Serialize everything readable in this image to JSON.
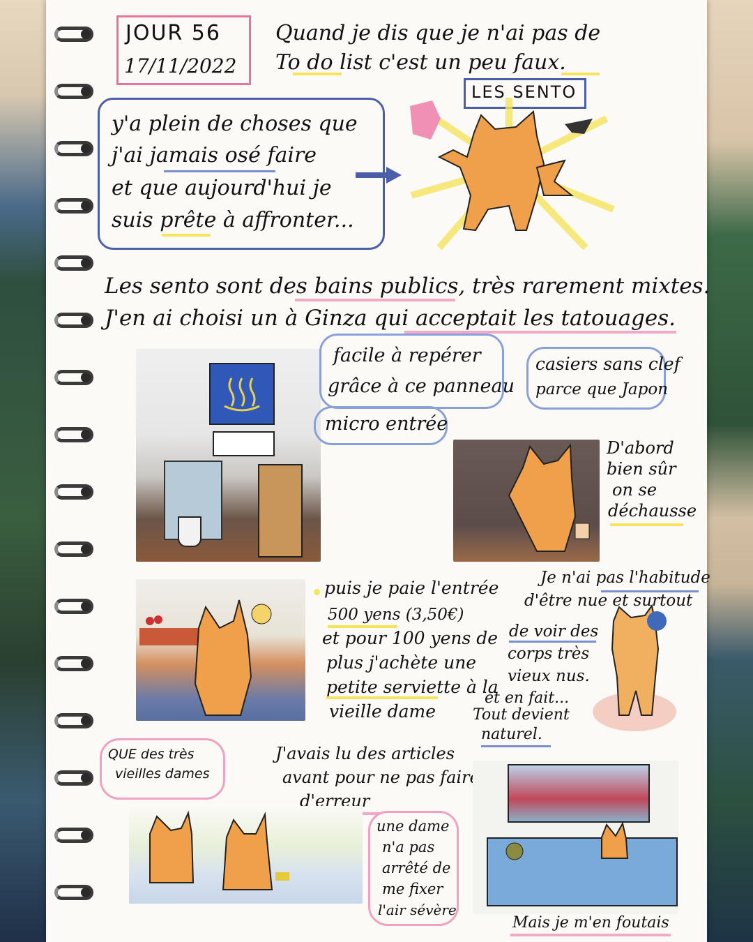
{
  "header": {
    "day_label": "JOUR 56",
    "date": "17/11/2022",
    "intro_line1": "Quand je dis que je n'ai pas de",
    "intro_line2": "To do list c'est un peu faux."
  },
  "bubble_top": {
    "line1": "y'a plein de choses que",
    "line2": "j'ai jamais osé faire",
    "line3": "et que aujourd'hui je",
    "line4": "suis prête à affronter..."
  },
  "sento_label": "LES SENTO",
  "paragraph": {
    "line1": "Les sento sont des bains publics, très rarement mixtes.",
    "line2": "J'en ai choisi un à Ginza qui acceptait les tatouages."
  },
  "notes": {
    "panel_sign_line1": "facile à repérer",
    "panel_sign_line2": "grâce à ce panneau",
    "micro_entree": "micro entrée",
    "casiers_line1": "casiers sans clef",
    "casiers_line2": "parce que Japon",
    "dabord_line1": "D'abord",
    "dabord_line2": "bien sûr",
    "dabord_line3": "on se",
    "dabord_line4": "déchausse",
    "paie_line1": "puis je paie l'entrée",
    "paie_line2": "500 yens (3,50€)",
    "paie_line3": "et pour 100 yens de",
    "paie_line4": "plus j'achète une",
    "paie_line5": "petite serviette à la",
    "paie_line6": "vieille dame",
    "habitude_line1": "Je n'ai pas l'habitude",
    "habitude_line2": "d'être nue et surtout",
    "habitude_line3": "de voir des",
    "habitude_line4": "corps très",
    "habitude_line5": "vieux nus.",
    "habitude_line6": "et en fait...",
    "habitude_line7": "Tout devient",
    "habitude_line8": "naturel.",
    "vieilles_line1": "QUE des très",
    "vieilles_line2": "vieilles dames",
    "articles_line1": "J'avais lu des articles",
    "articles_line2": "avant pour ne pas faire",
    "articles_line3": "d'erreur",
    "dame_line1": "une dame",
    "dame_line2": "n'a pas",
    "dame_line3": "arrêté de",
    "dame_line4": "me fixer",
    "dame_line5": "l'air sévère",
    "mais_line": "Mais je m'en foutais"
  },
  "colors": {
    "pink": "#e6749c",
    "blue": "#4a5fa8",
    "yellow": "#f6e45a",
    "fox": "#f0a04a"
  },
  "icons": {
    "onsen_sign": "hot-spring-icon",
    "arrow": "arrow-icon"
  }
}
